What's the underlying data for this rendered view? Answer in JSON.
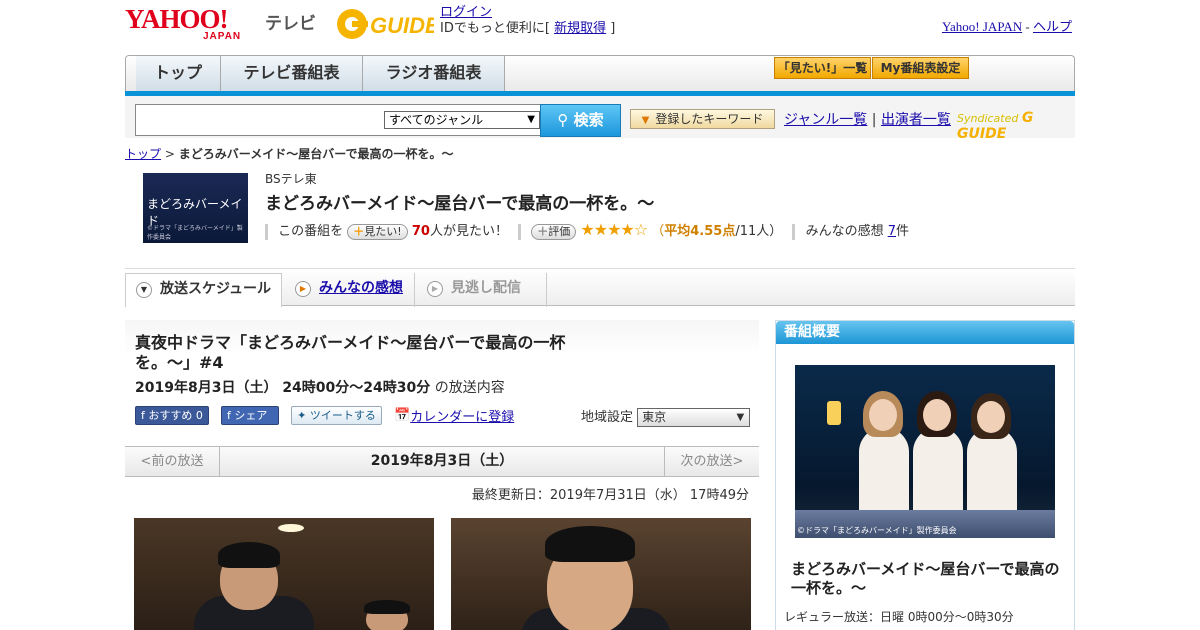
{
  "header": {
    "logo_text": "YAHOO!",
    "logo_sub": "JAPAN",
    "service": "テレビ",
    "gguide_text": "G GUIDE",
    "login": "ログイン",
    "login_note_prefix": "IDでもっと便利に[ ",
    "signup": "新規取得",
    "login_note_suffix": " ]",
    "yahoo_japan": "Yahoo! JAPAN",
    "dash": " - ",
    "help": "ヘルプ"
  },
  "nav": {
    "tabs": [
      "トップ",
      "テレビ番組表",
      "ラジオ番組表"
    ],
    "want_list": "「見たい!」一覧",
    "my_schedule": "My番組表設定"
  },
  "search": {
    "genre": "すべてのジャンル",
    "button": "検索",
    "keyword_button": "登録したキーワード",
    "genre_list": "ジャンル一覧",
    "divider": " | ",
    "performer_list": "出演者一覧",
    "syndicated": "Syndicated",
    "syndicated_g": "G GUIDE"
  },
  "breadcrumb": {
    "top": "トップ",
    "sep": " > ",
    "current": "まどろみバーメイド～屋台バーで最高の一杯を。～"
  },
  "program": {
    "thumb_title": "まどろみバーメイド",
    "thumb_copyright": "©ドラマ「まどろみバーメイド」製作委員会",
    "channel": "BSテレ東",
    "title": "まどろみバーメイド～屋台バーで最高の一杯を。～",
    "want_label": "この番組を",
    "want_button": "見たい!",
    "want_count": "70",
    "want_suffix": "人が見たい！",
    "rating_button": "評価",
    "stars": "★★★★☆",
    "avg_open": "（",
    "avg_label": "平均4.55点",
    "avg_suffix": "/11人）",
    "review_label": "みんなの感想",
    "review_count": "7",
    "review_unit": "件",
    "rating": 4.55
  },
  "tabs": {
    "schedule": "放送スケジュール",
    "review": "みんなの感想",
    "stream": "見逃し配信"
  },
  "episode": {
    "title": "真夜中ドラマ「まどろみバーメイド～屋台バーで最高の一杯を。～」#4",
    "datetime": "2019年8月3日（土）  24時00分～24時30分",
    "datetime_suffix": " の放送内容",
    "fb_recommend": "おすすめ 0",
    "fb_share": "シェア",
    "tweet": "ツイートする",
    "calendar": "カレンダーに登録",
    "region_label": "地域設定",
    "region_value": "東京"
  },
  "date_nav": {
    "prev": "<前の放送",
    "current": "2019年8月3日（土）",
    "next": "次の放送>"
  },
  "updated": "最終更新日：2019年7月31日（水） 17時49分",
  "sidebar": {
    "heading": "番組概要",
    "image_caption": "©ドラマ「まどろみバーメイド」製作委員会",
    "title": "まどろみバーメイド～屋台バーで最高の一杯を。～",
    "regular": "レギュラー放送：日曜 0時00分～0時30分"
  },
  "colors": {
    "accent_blue": "#0a92d6",
    "yahoo_red": "#e0001b",
    "link": "#1a0dab",
    "star": "#f0a000"
  }
}
